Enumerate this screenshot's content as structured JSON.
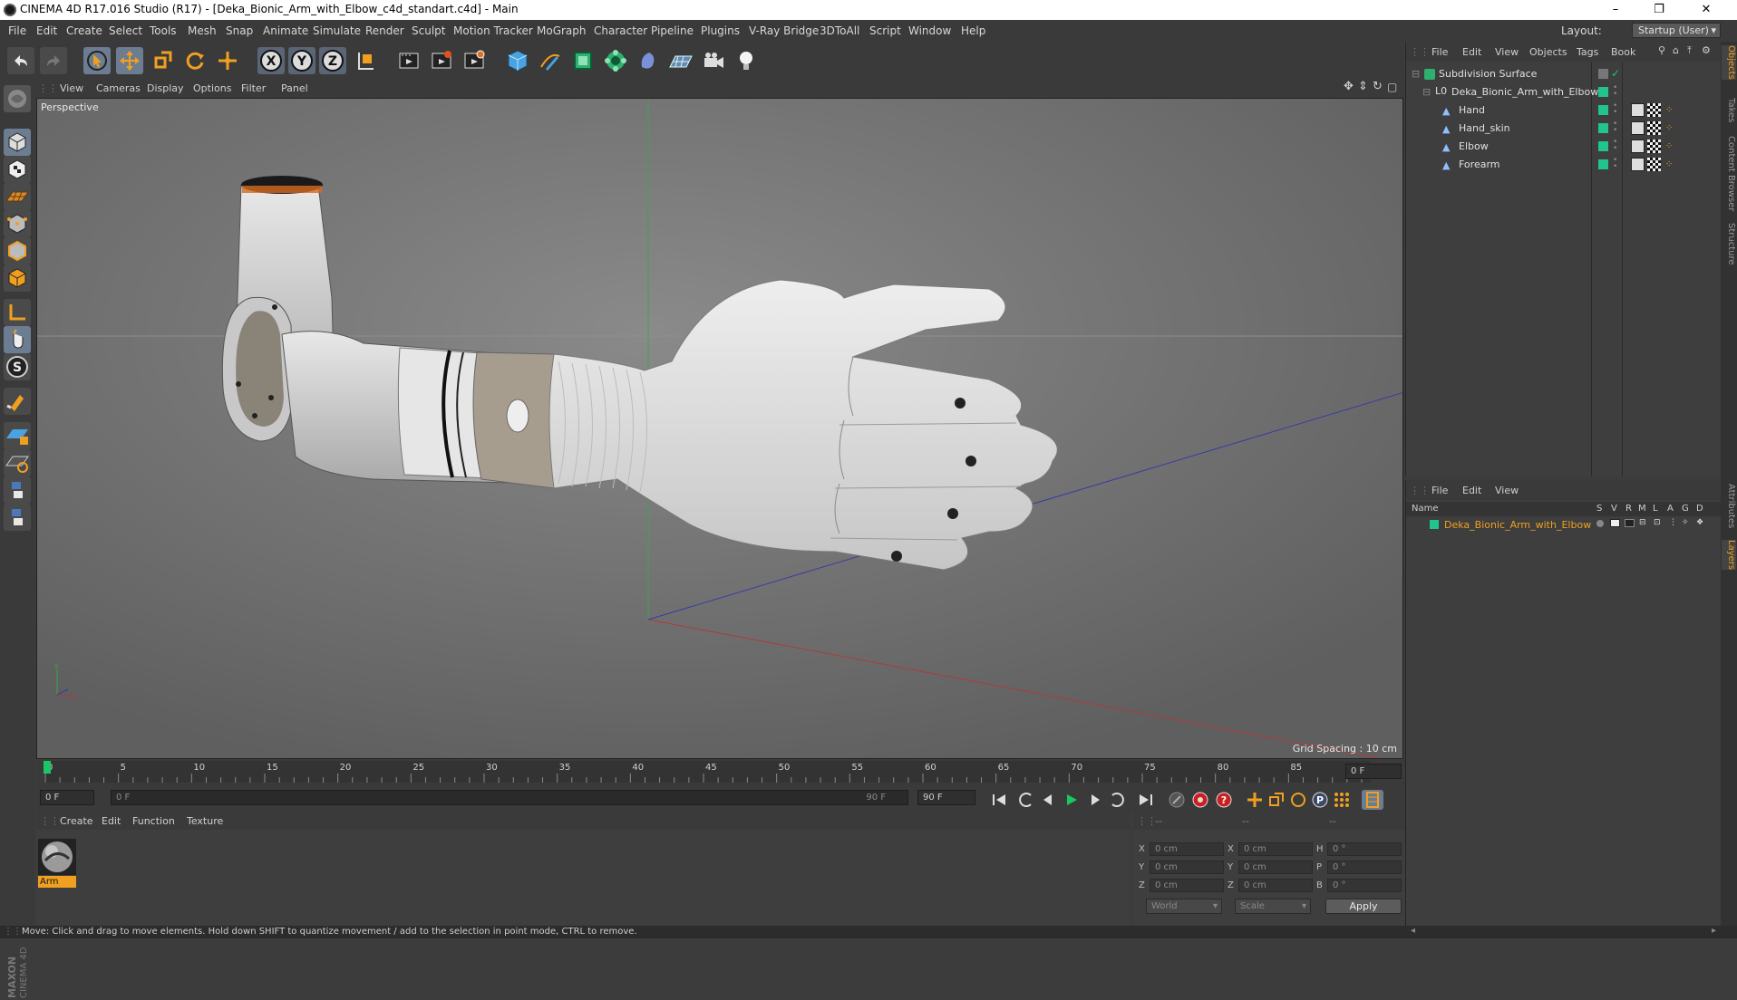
{
  "title_bar": {
    "title": "CINEMA 4D R17.016 Studio (R17) - [Deka_Bionic_Arm_with_Elbow_c4d_standart.c4d] - Main",
    "minimize": "–",
    "restore": "❐",
    "close": "✕"
  },
  "menu": {
    "items": [
      "File",
      "Edit",
      "Create",
      "Select",
      "Tools",
      "Mesh",
      "Snap",
      "Animate",
      "Simulate",
      "Render",
      "Sculpt",
      "Motion Tracker",
      "MoGraph",
      "Character",
      "Pipeline",
      "Plugins",
      "V-Ray Bridge",
      "3DToAll",
      "Script",
      "Window",
      "Help"
    ],
    "layout_label": "Layout:",
    "layout_value": "Startup (User)"
  },
  "viewport": {
    "menu": [
      "View",
      "Cameras",
      "Display",
      "Options",
      "Filter",
      "Panel"
    ],
    "label": "Perspective",
    "grid_spacing": "Grid Spacing : 10 cm"
  },
  "timeline": {
    "ticks": [
      "0",
      "5",
      "10",
      "15",
      "20",
      "25",
      "30",
      "35",
      "40",
      "45",
      "50",
      "55",
      "60",
      "65",
      "70",
      "75",
      "80",
      "85",
      "90"
    ],
    "current_frame": "0 F"
  },
  "transport": {
    "start_frame": "0 F",
    "range_start": "0 F",
    "range_end": "90 F",
    "end_frame": "90 F"
  },
  "material_panel": {
    "menu": [
      "Create",
      "Edit",
      "Function",
      "Texture"
    ],
    "materials": [
      {
        "name": "Arm"
      }
    ]
  },
  "coordinates": {
    "header": [
      "--",
      "--",
      "--"
    ],
    "rows": [
      {
        "label1": "X",
        "val1": "0 cm",
        "label2": "X",
        "val2": "0 cm",
        "label3": "H",
        "val3": "0 °"
      },
      {
        "label1": "Y",
        "val1": "0 cm",
        "label2": "Y",
        "val2": "0 cm",
        "label3": "P",
        "val3": "0 °"
      },
      {
        "label1": "Z",
        "val1": "0 cm",
        "label2": "Z",
        "val2": "0 cm",
        "label3": "B",
        "val3": "0 °"
      }
    ],
    "mode_world": "World",
    "mode_scale": "Scale",
    "apply": "Apply"
  },
  "object_manager": {
    "menu": [
      "File",
      "Edit",
      "View",
      "Objects",
      "Tags",
      "Bookm"
    ],
    "objects": [
      {
        "name": "Subdivision Surface",
        "indent": 0
      },
      {
        "name": "Deka_Bionic_Arm_with_Elbow",
        "indent": 1
      },
      {
        "name": "Hand",
        "indent": 2
      },
      {
        "name": "Hand_skin",
        "indent": 2
      },
      {
        "name": "Elbow",
        "indent": 2
      },
      {
        "name": "Forearm",
        "indent": 2
      }
    ]
  },
  "layer_manager": {
    "menu": [
      "File",
      "Edit",
      "View"
    ],
    "columns": [
      "Name",
      "S",
      "V",
      "R",
      "M",
      "L",
      "A",
      "G",
      "D"
    ],
    "layers": [
      {
        "name": "Deka_Bionic_Arm_with_Elbow",
        "color": "#21c48a"
      }
    ]
  },
  "right_tabs": [
    "Objects",
    "Takes",
    "Content Browser",
    "Structure",
    "Attributes",
    "Layers"
  ],
  "status": "Move: Click and drag to move elements. Hold down SHIFT to quantize movement / add to the selection in point mode, CTRL to remove.",
  "colors": {
    "accent": "#f0a020",
    "layer_green": "#21c48a",
    "playhead": "#19c864"
  }
}
